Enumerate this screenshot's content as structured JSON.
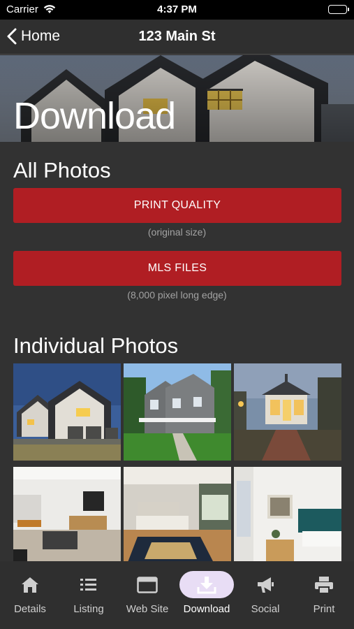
{
  "status_bar": {
    "carrier": "Carrier",
    "time": "4:37 PM"
  },
  "nav": {
    "back_label": "Home",
    "title": "123 Main St"
  },
  "hero": {
    "title": "Download"
  },
  "all_photos": {
    "heading": "All Photos",
    "print_quality_label": "PRINT QUALITY",
    "print_quality_caption": "(original size)",
    "mls_label": "MLS FILES",
    "mls_caption": "(8,000 pixel long edge)"
  },
  "individual": {
    "heading": "Individual Photos",
    "photos": [
      "exterior-dusk",
      "farmhouse-day",
      "gazebo-evening",
      "living-room",
      "bedroom-wood-floor",
      "bedroom-teal-headboard"
    ]
  },
  "tabs": [
    {
      "label": "Details",
      "icon": "home-icon",
      "active": false
    },
    {
      "label": "Listing",
      "icon": "list-icon",
      "active": false
    },
    {
      "label": "Web Site",
      "icon": "browser-icon",
      "active": false
    },
    {
      "label": "Download",
      "icon": "download-icon",
      "active": true
    },
    {
      "label": "Social",
      "icon": "megaphone-icon",
      "active": false
    },
    {
      "label": "Print",
      "icon": "printer-icon",
      "active": false
    }
  ],
  "colors": {
    "background": "#323232",
    "accent_red": "#b01e23",
    "active_pill": "#e8ddf5"
  }
}
